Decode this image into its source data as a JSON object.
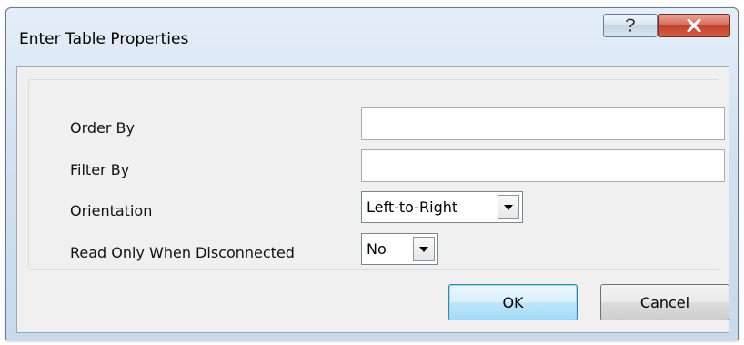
{
  "window": {
    "title": "Enter Table Properties",
    "help_icon": "help-question-icon",
    "close_icon": "close-x-icon"
  },
  "form": {
    "order_by": {
      "label": "Order By",
      "value": ""
    },
    "filter_by": {
      "label": "Filter By",
      "value": ""
    },
    "orientation": {
      "label": "Orientation",
      "value": "Left-to-Right"
    },
    "read_only": {
      "label": "Read Only When Disconnected",
      "value": "No"
    }
  },
  "buttons": {
    "ok": "OK",
    "cancel": "Cancel"
  },
  "colors": {
    "close_button": "#c3412c",
    "default_button_border": "#3c7fb1"
  }
}
